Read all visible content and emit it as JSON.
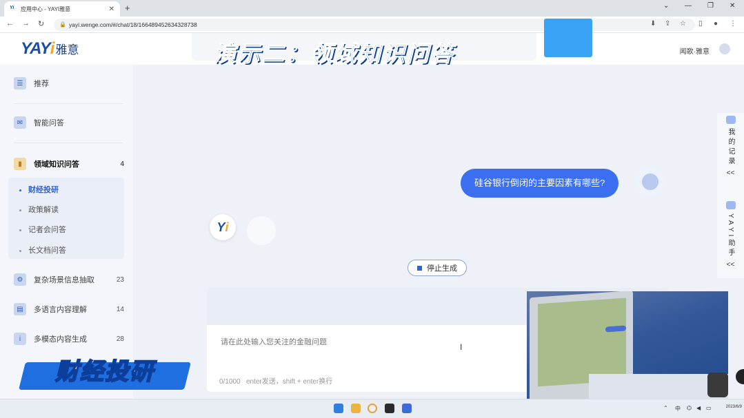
{
  "browser": {
    "tab_favicon": "Yi",
    "tab_title": "应用中心 - YAYI雅意",
    "url": "yayi.wenge.com/#/chat/18/16648945263432873​8"
  },
  "header": {
    "logo_en": "YAY",
    "logo_en_i": "i",
    "logo_cn": "雅意",
    "banner": "演示二：领域知识问答",
    "user": "闻歌·雅意"
  },
  "sidebar": {
    "items": [
      {
        "label": "推荐",
        "count": ""
      },
      {
        "label": "智能问答",
        "count": ""
      },
      {
        "label": "领域知识问答",
        "count": "4"
      },
      {
        "label": "复杂场景信息抽取",
        "count": "23"
      },
      {
        "label": "多语言内容理解",
        "count": "14"
      },
      {
        "label": "多模态内容生成",
        "count": "28"
      }
    ],
    "subitems": [
      "财经投研",
      "政策解读",
      "记者会问答",
      "长文档问答"
    ]
  },
  "badge": "财经投研",
  "chat": {
    "user_message": "硅谷银行倒闭的主要因素有哪些?",
    "bot_avatar": "Y",
    "bot_avatar_i": "i",
    "stop_label": "停止生成",
    "input_placeholder": "请在此处输入您关注的金融问题",
    "cursor": "I",
    "counter": "0/1000",
    "hint": "enter发送，shift + enter换行"
  },
  "rail": {
    "records": "我的记录",
    "assistant": "YAYI助手",
    "collapse": "<<"
  },
  "taskbar": {
    "lang": "中",
    "date": "2023/6/9"
  },
  "colors": {
    "accent": "#3b6ef0",
    "brand": "#1b4da0",
    "banner": "#1e73e8"
  }
}
